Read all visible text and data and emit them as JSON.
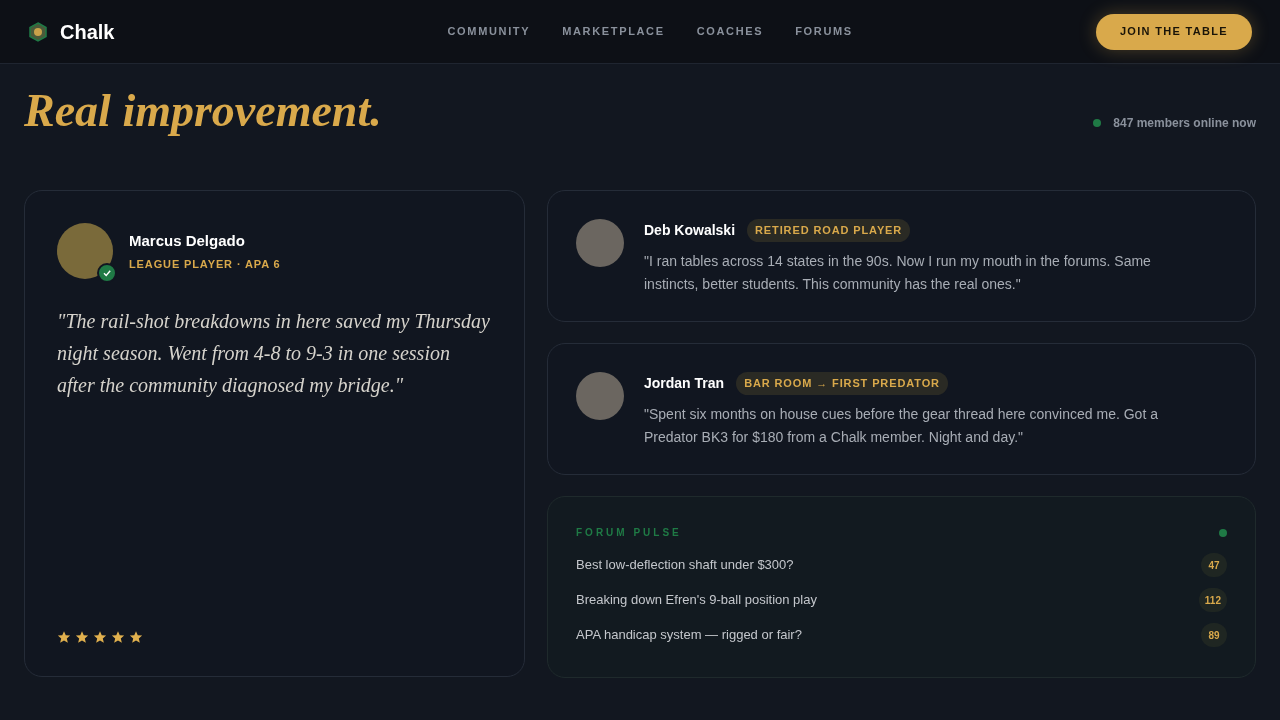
{
  "header": {
    "brand": "Chalk",
    "nav": [
      {
        "label": "COMMUNITY"
      },
      {
        "label": "MARKETPLACE"
      },
      {
        "label": "COACHES"
      },
      {
        "label": "FORUMS"
      }
    ],
    "cta": "JOIN THE TABLE"
  },
  "hero": {
    "line_2": "Real improvement.",
    "online": "847 members online now"
  },
  "featured": {
    "name": "Marcus Delgado",
    "role": "LEAGUE PLAYER · APA 6",
    "verified": true,
    "quote": "\"The rail-shot breakdowns in here saved my Thursday night season. Went from 4-8 to 9-3 in one session after the community diagnosed my bridge.\"",
    "stars": 5
  },
  "testimonials": [
    {
      "name": "Deb Kowalski",
      "tag": "RETIRED ROAD PLAYER",
      "quote": "\"I ran tables across 14 states in the 90s. Now I run my mouth in the forums. Same instincts, better students. This community has the real ones.\""
    },
    {
      "name": "Jordan Tran",
      "tag": "BAR ROOM → FIRST PREDATOR",
      "quote": "\"Spent six months on house cues before the gear thread here convinced me. Got a Predator BK3 for $180 from a Chalk member. Night and day.\""
    }
  ],
  "forum_pulse": {
    "title": "FORUM PULSE",
    "threads": [
      {
        "title": "Best low-deflection shaft under $300?",
        "count": "47"
      },
      {
        "title": "Breaking down Efren's 9-ball position play",
        "count": "112"
      },
      {
        "title": "APA handicap system — rigged or fair?",
        "count": "89"
      }
    ]
  }
}
